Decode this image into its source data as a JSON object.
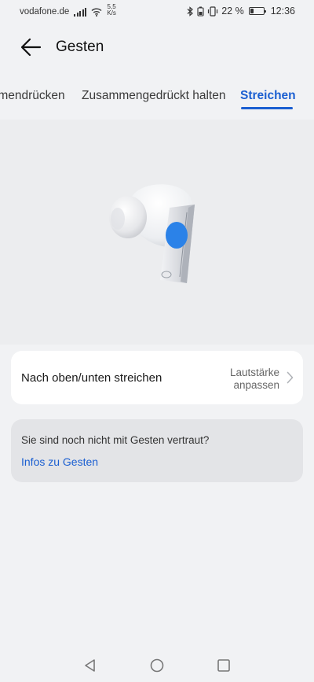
{
  "status_bar": {
    "carrier": "vodafone.de",
    "speed_value": "5,5",
    "speed_unit": "K/s",
    "battery_percent": "22 %",
    "battery_level": 0.22,
    "time": "12:36"
  },
  "header": {
    "title": "Gesten"
  },
  "tabs": [
    {
      "label": "Zusammendrücken",
      "selected": false
    },
    {
      "label": "Zusammengedrückt halten",
      "selected": false
    },
    {
      "label": "Streichen",
      "selected": true
    }
  ],
  "illustration": {
    "subject": "earbud",
    "highlight_color": "#2b82e8"
  },
  "setting": {
    "label": "Nach oben/unten streichen",
    "value_line1": "Lautstärke",
    "value_line2": "anpassen"
  },
  "info": {
    "question": "Sie sind noch nicht mit Gesten vertraut?",
    "link": "Infos zu Gesten"
  },
  "colors": {
    "accent": "#1b5fd1",
    "background": "#f1f2f4",
    "card": "#ffffff",
    "info_card": "#e3e4e7"
  },
  "navbar": {
    "icons": [
      "back-triangle-icon",
      "home-circle-icon",
      "recents-square-icon"
    ]
  }
}
